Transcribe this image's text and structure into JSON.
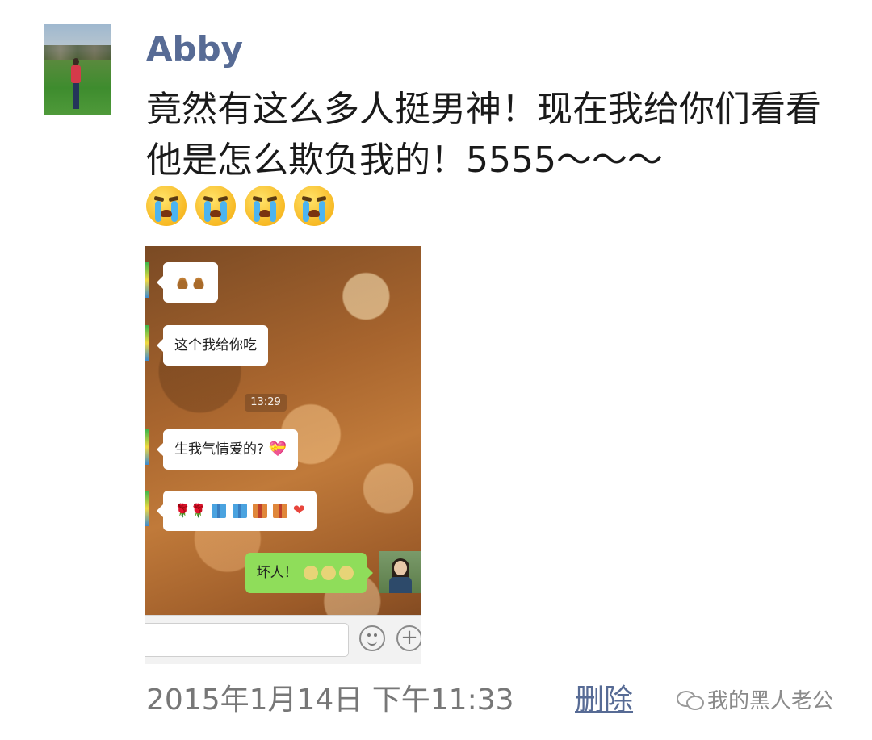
{
  "post": {
    "username": "Abby",
    "text": "竟然有这么多人挺男神！现在我给你们看看他是怎么欺负我的！5555～～～",
    "emoji_icons": [
      "crying-face-icon",
      "crying-face-icon",
      "crying-face-icon",
      "crying-face-icon"
    ],
    "timestamp": "2015年1月14日 下午11:33",
    "delete_label": "删除"
  },
  "chat_screenshot": {
    "messages": [
      {
        "side": "left",
        "text": "",
        "emojis": [
          "poop-icon",
          "poop-icon"
        ]
      },
      {
        "side": "left",
        "text": "这个我给你吃"
      },
      {
        "side": "left",
        "text": "生我气情爱的?",
        "emojis": [
          "heart-gift-icon"
        ]
      },
      {
        "side": "left",
        "text": "",
        "emojis": [
          "rose-icon",
          "rose-icon",
          "gift-icon",
          "gift-icon",
          "gift-icon",
          "gift-icon",
          "heart-icon"
        ]
      },
      {
        "side": "right",
        "text": "坏人！",
        "emojis": [
          "crying-face-icon",
          "crying-face-icon",
          "crying-face-icon"
        ]
      }
    ],
    "time": "13:29"
  },
  "watermark": {
    "text": "我的黑人老公"
  }
}
